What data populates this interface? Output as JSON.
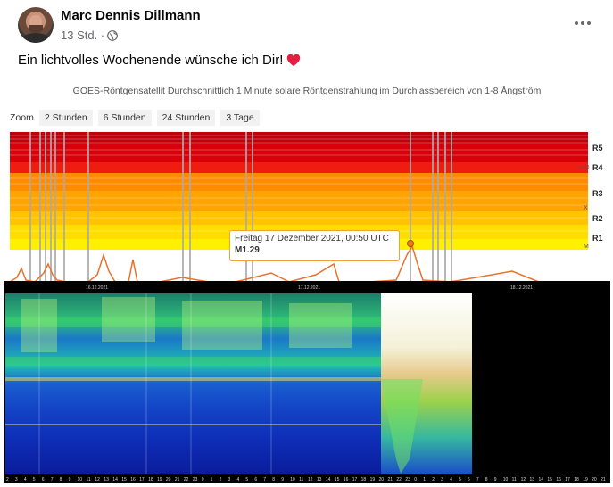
{
  "post": {
    "author": "Marc Dennis Dillmann",
    "time": "13 Std. ·",
    "text": "Ein lichtvolles Wochenende wünsche ich Dir!",
    "audience_icon": "globe-icon",
    "emoji_icon": "red-heart-icon"
  },
  "goes": {
    "title": "GOES-Röntgensatellit Durchschnittlich 1 Minute solare Röntgenstrahlung im Durchlassbereich von 1-8 Ångström",
    "zoom_label": "Zoom",
    "zoom_options": [
      "2 Stunden",
      "6 Stunden",
      "24 Stunden",
      "3 Tage"
    ],
    "band_labels": [
      "R5",
      "R4",
      "R3",
      "R2",
      "R1"
    ],
    "class_labels": [
      "X10",
      "X",
      "M"
    ],
    "tooltip_date": "Freitag 17 Dezember 2021, 00:50 UTC",
    "tooltip_value": "M1.29",
    "band_colors": [
      "#c2000b",
      "#e60d0d",
      "#ff8a00",
      "#ffb300",
      "#ffd400",
      "#ffee00"
    ]
  },
  "spectrogram": {
    "date_labels": [
      "16.12.2021",
      "17.12.2021",
      "18.12.2021"
    ],
    "hour_labels": [
      "2",
      "3",
      "4",
      "5",
      "6",
      "7",
      "8",
      "9",
      "10",
      "11",
      "12",
      "13",
      "14",
      "15",
      "16",
      "17",
      "18",
      "19",
      "20",
      "21",
      "22",
      "23",
      "0",
      "1",
      "2",
      "3",
      "4",
      "5",
      "6",
      "7",
      "8",
      "9",
      "10",
      "11",
      "12",
      "13",
      "14",
      "15",
      "16",
      "17",
      "18",
      "19",
      "20",
      "21",
      "22",
      "23",
      "0",
      "1",
      "2",
      "3",
      "4",
      "5",
      "6",
      "7",
      "8",
      "9",
      "10",
      "11",
      "12",
      "13",
      "14",
      "15",
      "16",
      "17",
      "18",
      "19",
      "20",
      "21"
    ]
  }
}
